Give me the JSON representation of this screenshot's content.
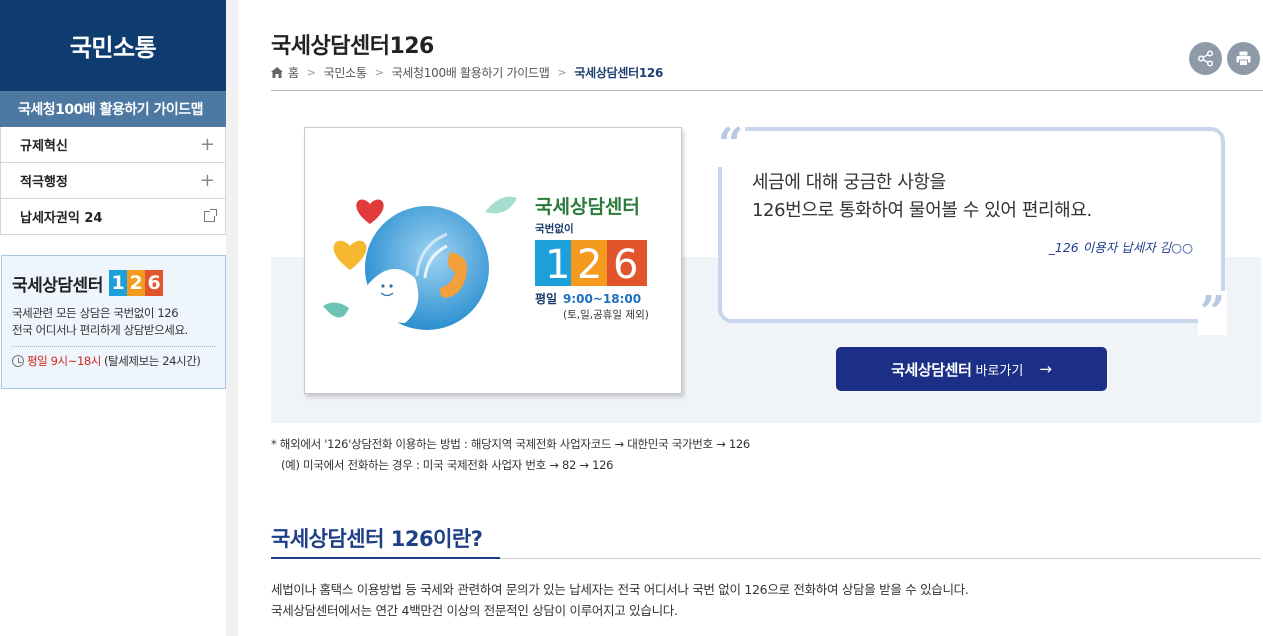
{
  "sidebar": {
    "heading": "국민소통",
    "active_item": "국세청100배 활용하기 가이드맵",
    "items": [
      {
        "label": "규제혁신",
        "icon": "plus-icon"
      },
      {
        "label": "적극행정",
        "icon": "plus-icon"
      },
      {
        "label": "납세자권익 24",
        "icon": "external-link-icon"
      }
    ],
    "banner": {
      "title": "국세상담센터",
      "number_digits": [
        "1",
        "2",
        "6"
      ],
      "number_colors": [
        "#1d9fd9",
        "#f39a1f",
        "#e2542c"
      ],
      "desc_line1": "국세관련 모든 상담은 국번없이 126",
      "desc_line2": "전국 어디서나 편리하게 상담받으세요.",
      "time_red": "평일 9시~18시",
      "time_rest": "(탈세제보는 24시간)"
    }
  },
  "header": {
    "title": "국세상담센터126",
    "breadcrumb": [
      "홈",
      "국민소통",
      "국세청100배 활용하기 가이드맵",
      "국세상담센터126"
    ],
    "share_icon": "share-icon",
    "print_icon": "print-icon"
  },
  "hero": {
    "image": {
      "title": "국세상담센터",
      "sub": "국번없이",
      "number": "126",
      "hours_label": "평일",
      "hours": "9:00~18:00",
      "note": "(토,일,공휴일 제외)"
    },
    "quote_line1": "세금에 대해 궁금한 사항을",
    "quote_line2": "126번으로 통화하여 물어볼 수 있어 편리해요.",
    "quote_author": "_126 이용자 납세자 김○○",
    "cta_bold": "국세상담센터",
    "cta_rest": "바로가기",
    "cta_arrow": "→"
  },
  "notes": {
    "line1": "* 해외에서 '126'상담전화 이용하는 방법 : 해당지역 국제전화 사업자코드 → 대한민국 국가번호 → 126",
    "line2": "(예) 미국에서 전화하는 경우 : 미국 국제전화 사업자 번호 → 82 → 126"
  },
  "section": {
    "title": "국세상담센터 126이란?",
    "body_line1": "세법이나 홈택스 이용방법 등 국세와 관련하여 문의가 있는 납세자는 전국 어디서나 국번 없이 126으로 전화하여 상담을 받을 수 있습니다.",
    "body_line2": "국세상담센터에서는 연간 4백만건 이상의 전문적인 상담이 이루어지고 있습니다."
  }
}
